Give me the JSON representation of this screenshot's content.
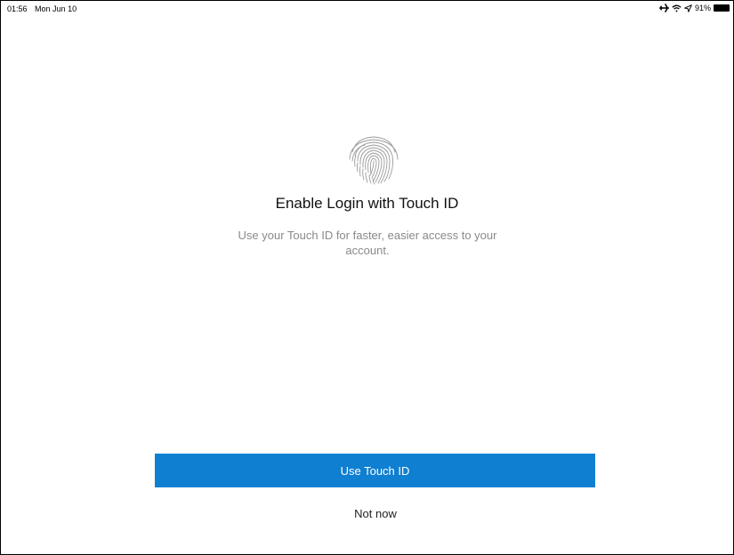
{
  "status_bar": {
    "time": "01:56",
    "date": "Mon Jun 10",
    "battery_text": "91%",
    "battery_level": 0.91,
    "icons": [
      "airplane-icon",
      "wifi-icon",
      "location-arrow-icon",
      "battery-icon"
    ]
  },
  "main": {
    "icon": "fingerprint-icon",
    "title": "Enable Login with Touch ID",
    "subtitle": "Use your Touch ID for faster, easier access to your account.",
    "primary_button_label": "Use Touch ID",
    "secondary_button_label": "Not now"
  },
  "colors": {
    "primary_button": "#0f7fd1",
    "subtitle_text": "#8a8a8a",
    "fingerprint": "#9a9a9a"
  }
}
